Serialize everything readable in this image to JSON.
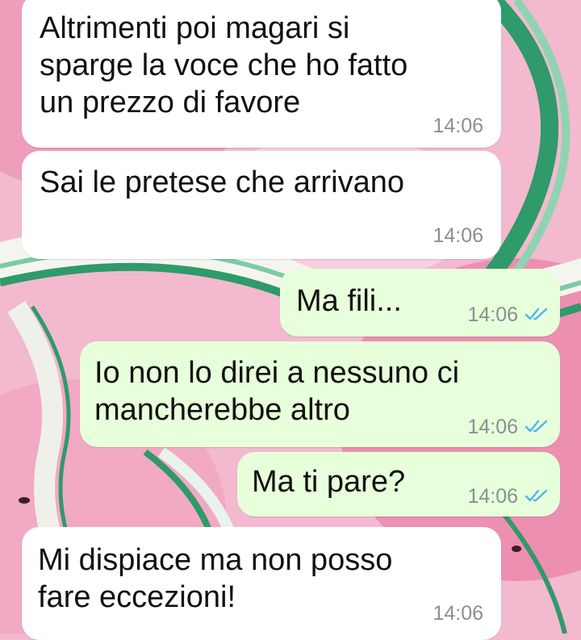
{
  "chat": {
    "messages": [
      {
        "direction": "incoming",
        "text": "Altrimenti poi magari si\nsparge la voce che ho fatto\nun prezzo di favore",
        "time": "14:06"
      },
      {
        "direction": "incoming",
        "text": "Sai le pretese che arrivano",
        "time": "14:06"
      },
      {
        "direction": "outgoing",
        "text": "Ma fili...",
        "time": "14:06",
        "status": "read"
      },
      {
        "direction": "outgoing",
        "text": "Io non lo direi a nessuno ci\nmancherebbe altro",
        "time": "14:06",
        "status": "read"
      },
      {
        "direction": "outgoing",
        "text": "Ma ti pare?",
        "time": "14:06",
        "status": "read"
      },
      {
        "direction": "incoming",
        "text": "Mi dispiace ma non posso\nfare eccezioni!",
        "time": "14:06"
      }
    ]
  },
  "colors": {
    "incoming_bubble": "#ffffff",
    "outgoing_bubble": "#e7ffdb",
    "read_tick": "#4fb6ec",
    "wallpaper_pink": "#f3b9cf",
    "wallpaper_green": "#2f9a6a"
  },
  "icons": {
    "read_status": "double-check-icon"
  }
}
